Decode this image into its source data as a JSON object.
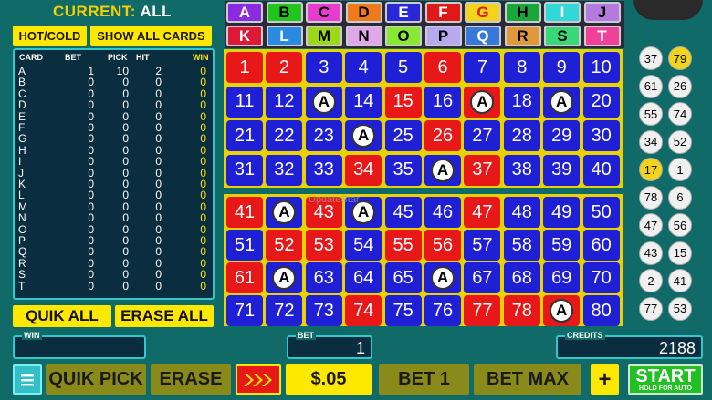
{
  "header": {
    "current_label": "CURRENT:",
    "current_value": "ALL"
  },
  "buttons": {
    "hot_cold": "HOT/COLD",
    "show_all_cards": "SHOW ALL CARDS",
    "quik_all": "QUIK ALL",
    "erase_all": "ERASE ALL",
    "quik_pick": "QUIK PICK",
    "erase": "ERASE",
    "denomination": "$.05",
    "bet_one": "BET 1",
    "bet_max": "BET MAX",
    "plus": "+",
    "start": "START",
    "start_sub": "HOLD FOR AUTO"
  },
  "card_table": {
    "headers": [
      "CARD",
      "BET",
      "PICK",
      "HIT",
      "WIN"
    ],
    "rows": [
      [
        "A",
        "1",
        "10",
        "2",
        "0"
      ],
      [
        "B",
        "0",
        "0",
        "0",
        "0"
      ],
      [
        "C",
        "0",
        "0",
        "0",
        "0"
      ],
      [
        "D",
        "0",
        "0",
        "0",
        "0"
      ],
      [
        "E",
        "0",
        "0",
        "0",
        "0"
      ],
      [
        "F",
        "0",
        "0",
        "0",
        "0"
      ],
      [
        "G",
        "0",
        "0",
        "0",
        "0"
      ],
      [
        "H",
        "0",
        "0",
        "0",
        "0"
      ],
      [
        "I",
        "0",
        "0",
        "0",
        "0"
      ],
      [
        "J",
        "0",
        "0",
        "0",
        "0"
      ],
      [
        "K",
        "0",
        "0",
        "0",
        "0"
      ],
      [
        "L",
        "0",
        "0",
        "0",
        "0"
      ],
      [
        "M",
        "0",
        "0",
        "0",
        "0"
      ],
      [
        "N",
        "0",
        "0",
        "0",
        "0"
      ],
      [
        "O",
        "0",
        "0",
        "0",
        "0"
      ],
      [
        "P",
        "0",
        "0",
        "0",
        "0"
      ],
      [
        "Q",
        "0",
        "0",
        "0",
        "0"
      ],
      [
        "R",
        "0",
        "0",
        "0",
        "0"
      ],
      [
        "S",
        "0",
        "0",
        "0",
        "0"
      ],
      [
        "T",
        "0",
        "0",
        "0",
        "0"
      ]
    ]
  },
  "card_letters": [
    {
      "letter": "A",
      "color": "#8a2be2",
      "text": "#ffffff"
    },
    {
      "letter": "B",
      "color": "#22c51e",
      "text": "#000000"
    },
    {
      "letter": "C",
      "color": "#e83cd0",
      "text": "#000000"
    },
    {
      "letter": "D",
      "color": "#f07a1a",
      "text": "#000000"
    },
    {
      "letter": "E",
      "color": "#2828d8",
      "text": "#ffffff"
    },
    {
      "letter": "F",
      "color": "#e01818",
      "text": "#ffffff"
    },
    {
      "letter": "G",
      "color": "#f2d41c",
      "text": "#e01818"
    },
    {
      "letter": "H",
      "color": "#18a83a",
      "text": "#000000"
    },
    {
      "letter": "I",
      "color": "#32d8d8",
      "text": "#ffffff"
    },
    {
      "letter": "J",
      "color": "#b47ae0",
      "text": "#000000"
    },
    {
      "letter": "K",
      "color": "#e01838",
      "text": "#ffffff"
    },
    {
      "letter": "L",
      "color": "#2a8ae0",
      "text": "#ffffff"
    },
    {
      "letter": "M",
      "color": "#9cd818",
      "text": "#000000"
    },
    {
      "letter": "N",
      "color": "#e0a8e8",
      "text": "#000000"
    },
    {
      "letter": "O",
      "color": "#88ea30",
      "text": "#000000"
    },
    {
      "letter": "P",
      "color": "#b8a8f0",
      "text": "#000000"
    },
    {
      "letter": "Q",
      "color": "#3878d8",
      "text": "#ffffff"
    },
    {
      "letter": "R",
      "color": "#e09838",
      "text": "#000000"
    },
    {
      "letter": "S",
      "color": "#38d878",
      "text": "#000000"
    },
    {
      "letter": "T",
      "color": "#f04098",
      "text": "#ffffff"
    }
  ],
  "board": {
    "cells": [
      {
        "n": "1",
        "c": "red"
      },
      {
        "n": "2",
        "c": "red"
      },
      {
        "n": "3",
        "c": "blue"
      },
      {
        "n": "4",
        "c": "blue"
      },
      {
        "n": "5",
        "c": "blue"
      },
      {
        "n": "6",
        "c": "red"
      },
      {
        "n": "7",
        "c": "blue"
      },
      {
        "n": "8",
        "c": "blue"
      },
      {
        "n": "9",
        "c": "blue"
      },
      {
        "n": "10",
        "c": "blue"
      },
      {
        "n": "11",
        "c": "blue"
      },
      {
        "n": "12",
        "c": "blue"
      },
      {
        "n": "A",
        "c": "blue"
      },
      {
        "n": "14",
        "c": "blue"
      },
      {
        "n": "15",
        "c": "red"
      },
      {
        "n": "16",
        "c": "blue"
      },
      {
        "n": "A",
        "c": "red"
      },
      {
        "n": "18",
        "c": "blue"
      },
      {
        "n": "A",
        "c": "blue"
      },
      {
        "n": "20",
        "c": "blue"
      },
      {
        "n": "21",
        "c": "blue"
      },
      {
        "n": "22",
        "c": "blue"
      },
      {
        "n": "23",
        "c": "blue"
      },
      {
        "n": "A",
        "c": "blue"
      },
      {
        "n": "25",
        "c": "blue"
      },
      {
        "n": "26",
        "c": "red"
      },
      {
        "n": "27",
        "c": "blue"
      },
      {
        "n": "28",
        "c": "blue"
      },
      {
        "n": "29",
        "c": "blue"
      },
      {
        "n": "30",
        "c": "blue"
      },
      {
        "n": "31",
        "c": "blue"
      },
      {
        "n": "32",
        "c": "blue"
      },
      {
        "n": "33",
        "c": "blue"
      },
      {
        "n": "34",
        "c": "red"
      },
      {
        "n": "35",
        "c": "blue"
      },
      {
        "n": "A",
        "c": "blue"
      },
      {
        "n": "37",
        "c": "red"
      },
      {
        "n": "38",
        "c": "blue"
      },
      {
        "n": "39",
        "c": "blue"
      },
      {
        "n": "40",
        "c": "blue"
      },
      {
        "n": "41",
        "c": "red"
      },
      {
        "n": "A",
        "c": "blue"
      },
      {
        "n": "43",
        "c": "red"
      },
      {
        "n": "A",
        "c": "blue"
      },
      {
        "n": "45",
        "c": "blue"
      },
      {
        "n": "46",
        "c": "blue"
      },
      {
        "n": "47",
        "c": "red"
      },
      {
        "n": "48",
        "c": "blue"
      },
      {
        "n": "49",
        "c": "blue"
      },
      {
        "n": "50",
        "c": "blue"
      },
      {
        "n": "51",
        "c": "blue"
      },
      {
        "n": "52",
        "c": "red"
      },
      {
        "n": "53",
        "c": "red"
      },
      {
        "n": "54",
        "c": "blue"
      },
      {
        "n": "55",
        "c": "red"
      },
      {
        "n": "56",
        "c": "red"
      },
      {
        "n": "57",
        "c": "blue"
      },
      {
        "n": "58",
        "c": "blue"
      },
      {
        "n": "59",
        "c": "blue"
      },
      {
        "n": "60",
        "c": "blue"
      },
      {
        "n": "61",
        "c": "red"
      },
      {
        "n": "A",
        "c": "blue"
      },
      {
        "n": "63",
        "c": "blue"
      },
      {
        "n": "64",
        "c": "blue"
      },
      {
        "n": "65",
        "c": "blue"
      },
      {
        "n": "A",
        "c": "blue"
      },
      {
        "n": "67",
        "c": "blue"
      },
      {
        "n": "68",
        "c": "blue"
      },
      {
        "n": "69",
        "c": "blue"
      },
      {
        "n": "70",
        "c": "blue"
      },
      {
        "n": "71",
        "c": "blue"
      },
      {
        "n": "72",
        "c": "blue"
      },
      {
        "n": "73",
        "c": "blue"
      },
      {
        "n": "74",
        "c": "red"
      },
      {
        "n": "75",
        "c": "blue"
      },
      {
        "n": "76",
        "c": "blue"
      },
      {
        "n": "77",
        "c": "red"
      },
      {
        "n": "78",
        "c": "red"
      },
      {
        "n": "A",
        "c": "red"
      },
      {
        "n": "80",
        "c": "blue"
      }
    ]
  },
  "drawn_balls": [
    {
      "n": "37",
      "hot": false
    },
    {
      "n": "79",
      "hot": true
    },
    {
      "n": "61",
      "hot": false
    },
    {
      "n": "26",
      "hot": false
    },
    {
      "n": "55",
      "hot": false
    },
    {
      "n": "74",
      "hot": false
    },
    {
      "n": "34",
      "hot": false
    },
    {
      "n": "52",
      "hot": false
    },
    {
      "n": "17",
      "hot": true
    },
    {
      "n": "1",
      "hot": false
    },
    {
      "n": "78",
      "hot": false
    },
    {
      "n": "6",
      "hot": false
    },
    {
      "n": "47",
      "hot": false
    },
    {
      "n": "56",
      "hot": false
    },
    {
      "n": "43",
      "hot": false
    },
    {
      "n": "15",
      "hot": false
    },
    {
      "n": "2",
      "hot": false
    },
    {
      "n": "41",
      "hot": false
    },
    {
      "n": "77",
      "hot": false
    },
    {
      "n": "53",
      "hot": false
    }
  ],
  "watermark": "UpdateStar",
  "meters": {
    "win_label": "WIN",
    "win_value": "",
    "bet_label": "BET",
    "bet_value": "1",
    "credits_label": "CREDITS",
    "credits_value": "2188"
  },
  "colors": {
    "panel_bg": "#0f6a68",
    "accent_yellow": "#ffe800",
    "cyan_border": "#34c7c7",
    "blue_cell": "#1f1fd6",
    "red_cell": "#e81818",
    "start_green": "#22c022"
  }
}
